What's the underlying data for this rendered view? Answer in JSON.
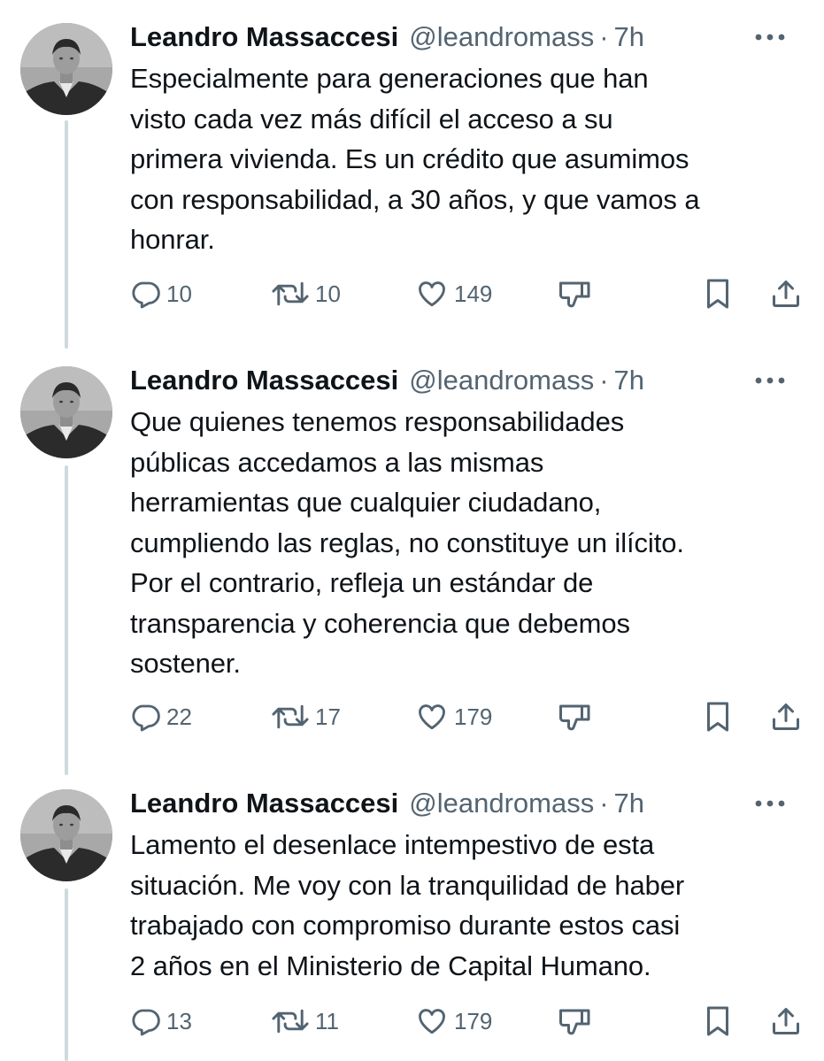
{
  "tweets": [
    {
      "author": "Leandro Massaccesi",
      "handle": "@leandromass",
      "separator": "·",
      "time": "7h",
      "text": "Especialmente para generaciones que han\nvisto cada vez más difícil el acceso a su\nprimera vivienda. Es un crédito que asumimos\ncon responsabilidad, a 30 años, y que vamos a\nhonrar.",
      "replies": "10",
      "reposts": "10",
      "likes": "149"
    },
    {
      "author": "Leandro Massaccesi",
      "handle": "@leandromass",
      "separator": "·",
      "time": "7h",
      "text": "Que quienes tenemos responsabilidades\npúblicas accedamos a las mismas\nherramientas que cualquier ciudadano,\ncumpliendo las reglas, no constituye un ilícito.\nPor el contrario, refleja un estándar de\ntransparencia y coherencia que debemos\nsostener.",
      "replies": "22",
      "reposts": "17",
      "likes": "179"
    },
    {
      "author": "Leandro Massaccesi",
      "handle": "@leandromass",
      "separator": "·",
      "time": "7h",
      "text": "Lamento el desenlace intempestivo de esta\nsituación. Me voy con la tranquilidad de haber\ntrabajado con compromiso durante estos casi\n2 años  en el Ministerio de Capital Humano.",
      "replies": "13",
      "reposts": "11",
      "likes": "179"
    }
  ],
  "icons": {
    "avatar": "avatar-photo",
    "more": "more-icon",
    "reply": "reply-icon",
    "repost": "repost-icon",
    "like": "like-icon",
    "downvote": "downvote-icon",
    "bookmark": "bookmark-icon",
    "share": "share-icon"
  },
  "colors": {
    "text": "#0f1419",
    "secondary": "#536471",
    "thread_line": "#cfd9de",
    "background": "#ffffff"
  }
}
